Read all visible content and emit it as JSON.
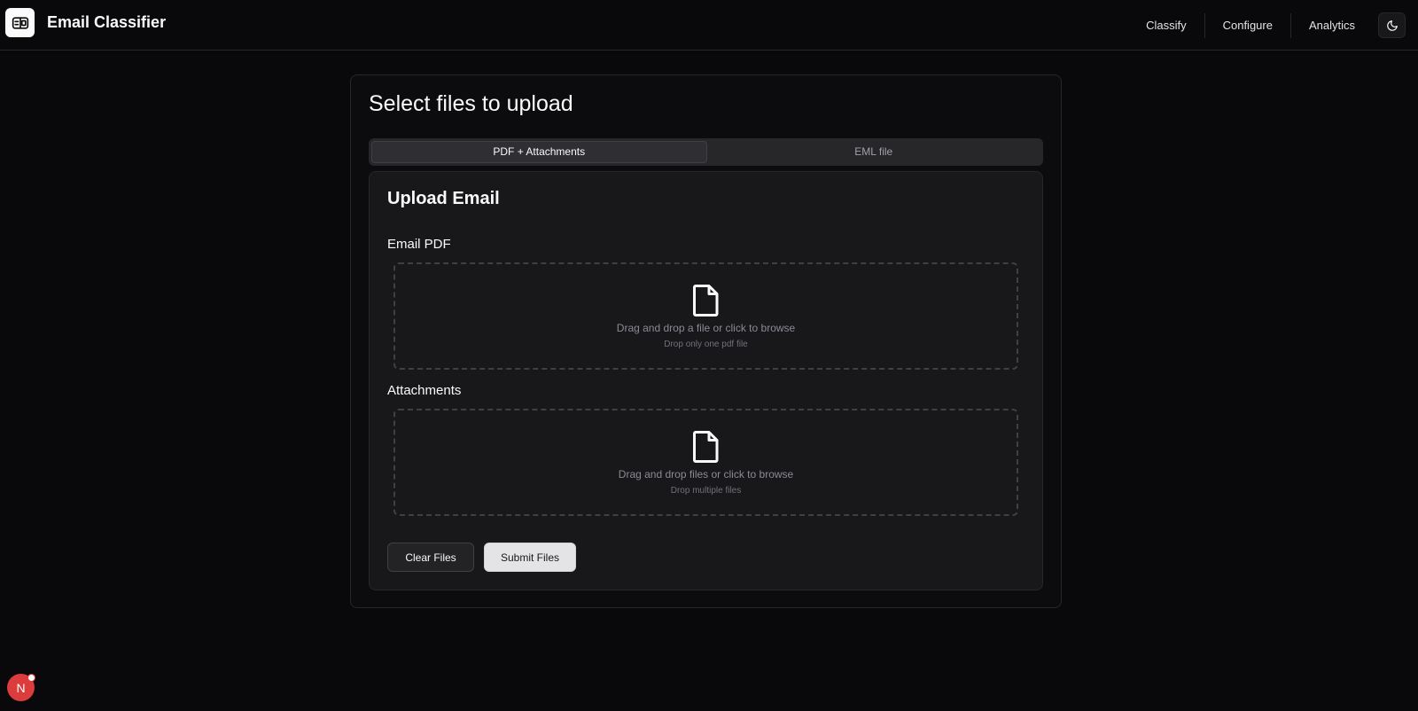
{
  "app": {
    "title": "Email Classifier",
    "logo_icon": "newspaper-icon"
  },
  "nav": {
    "items": [
      {
        "label": "Classify"
      },
      {
        "label": "Configure"
      },
      {
        "label": "Analytics"
      }
    ],
    "theme_icon": "moon-icon"
  },
  "upload": {
    "title": "Select files to upload",
    "tabs": [
      {
        "label": "PDF + Attachments",
        "active": true
      },
      {
        "label": "EML file",
        "active": false
      }
    ],
    "card_title": "Upload Email",
    "pdf": {
      "label": "Email PDF",
      "main_text": "Drag and drop a file or click to browse",
      "sub_text": "Drop only one pdf file",
      "icon": "file-icon"
    },
    "attachments": {
      "label": "Attachments",
      "main_text": "Drag and drop files or click to browse",
      "sub_text": "Drop multiple files",
      "icon": "file-icon"
    },
    "clear_label": "Clear Files",
    "submit_label": "Submit Files"
  },
  "user": {
    "initial": "N"
  },
  "colors": {
    "background": "#09090b",
    "card": "#18181b",
    "border": "#27272a",
    "avatar": "#dc3c3c"
  }
}
